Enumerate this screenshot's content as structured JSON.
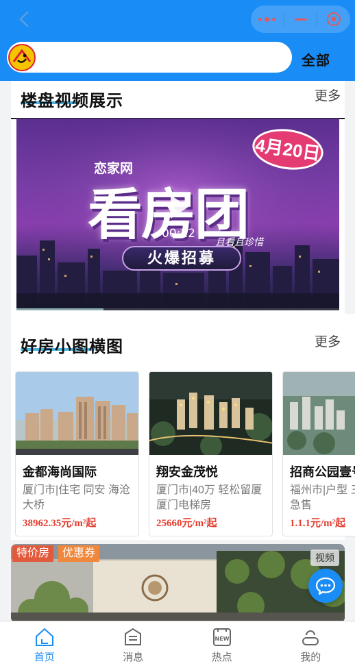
{
  "header": {
    "all_label": "全部"
  },
  "video_section": {
    "title": "楼盘视频展示",
    "more_label": "更多",
    "video": {
      "brand": "恋家网",
      "headline": "看房团",
      "date_badge": "4月20日",
      "slogan": "且看且珍惜",
      "recruit": "火爆招募",
      "duration": "00:12",
      "progress": 0.27
    }
  },
  "house_section": {
    "title": "好房小图横图",
    "more_label": "更多",
    "cards": [
      {
        "name": "金都海尚国际",
        "desc": "厦门市|住宅 同安 海沧大桥",
        "price": "38962.35元/m²起"
      },
      {
        "name": "翔安金茂悦",
        "desc": "厦门市|40万 轻松留厦 厦门电梯房",
        "price": "25660元/m²起"
      },
      {
        "name": "招商公园壹号",
        "desc": "福州市|户型 三房 稳定急售",
        "price": "1.1.1元/m²起"
      }
    ]
  },
  "banner": {
    "tag_special": "特价房",
    "tag_coupon": "优惠券",
    "tag_video": "视频"
  },
  "tabbar": {
    "items": [
      {
        "label": "首页",
        "icon": "home-icon",
        "active": true
      },
      {
        "label": "消息",
        "icon": "message-icon",
        "active": false
      },
      {
        "label": "热点",
        "icon": "news-icon",
        "active": false
      },
      {
        "label": "我的",
        "icon": "user-icon",
        "active": false
      }
    ],
    "new_badge": "NEW"
  },
  "colors": {
    "primary": "#1a8cf5",
    "price": "#e53d2f",
    "tag_special": "#e25a3c",
    "tag_coupon": "#f0873b"
  }
}
